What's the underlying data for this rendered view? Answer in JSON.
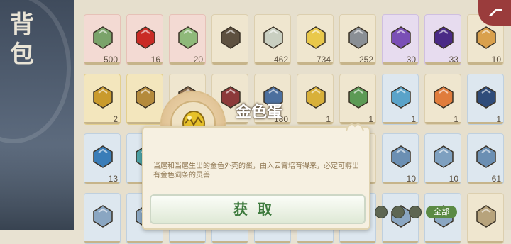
{
  "sidebar": {
    "title": "背包"
  },
  "inventory": {
    "rows": [
      [
        {
          "name": "shell-icon",
          "count": "500",
          "tint": "pink",
          "color": "#7aa36a"
        },
        {
          "name": "red-orb-icon",
          "count": "16",
          "tint": "pink",
          "color": "#c92b25"
        },
        {
          "name": "green-bun-icon",
          "count": "20",
          "tint": "pink",
          "color": "#8fb97a"
        },
        {
          "name": "dark-nut-icon",
          "count": "",
          "tint": "",
          "color": "#5e5140"
        },
        {
          "name": "bowl-icon",
          "count": "462",
          "tint": "",
          "color": "#c9cfc1"
        },
        {
          "name": "yellow-cake-icon",
          "count": "734",
          "tint": "",
          "color": "#e9c84a"
        },
        {
          "name": "grey-ore-icon",
          "count": "252",
          "tint": "",
          "color": "#8a8f95"
        },
        {
          "name": "purple-crystal-icon",
          "count": "30",
          "tint": "purple",
          "color": "#7a4fb6"
        },
        {
          "name": "purple-orb-icon",
          "count": "33",
          "tint": "purple",
          "color": "#4a2a86"
        },
        {
          "name": "food-icon",
          "count": "10",
          "tint": "",
          "color": "#d9a04c"
        }
      ],
      [
        {
          "name": "amber-crystal-icon",
          "count": "2",
          "tint": "gold",
          "color": "#c99a2c"
        },
        {
          "name": "scroll-icon",
          "count": "",
          "tint": "gold",
          "color": "#b48a3c"
        },
        {
          "name": "book-icon",
          "count": "",
          "tint": "",
          "color": "#8a6a4c"
        },
        {
          "name": "red-book-icon",
          "count": "",
          "tint": "",
          "color": "#8c3a3a"
        },
        {
          "name": "blue-card-icon",
          "count": "180",
          "tint": "",
          "color": "#4b6f9e"
        },
        {
          "name": "gold-ore-icon",
          "count": "1",
          "tint": "",
          "color": "#d8b03a"
        },
        {
          "name": "green-leaf-icon",
          "count": "1",
          "tint": "",
          "color": "#5c9a55"
        },
        {
          "name": "blue-gem-icon",
          "count": "1",
          "tint": "blue",
          "color": "#5aa3c9"
        },
        {
          "name": "orange-flower-icon",
          "count": "1",
          "tint": "",
          "color": "#e07c3c"
        },
        {
          "name": "dark-blue-gem-icon",
          "count": "1",
          "tint": "blue",
          "color": "#2f4c7a"
        }
      ],
      [
        {
          "name": "blue-orb-icon",
          "count": "13",
          "tint": "blue",
          "color": "#3a7db8"
        },
        {
          "name": "teal-feather-icon",
          "count": "",
          "tint": "blue",
          "color": "#4ba0a4"
        },
        {
          "name": "item-icon",
          "count": "",
          "tint": "",
          "color": "#b7a37c"
        },
        {
          "name": "item-icon",
          "count": "",
          "tint": "",
          "color": "#b7a37c"
        },
        {
          "name": "item-icon",
          "count": "",
          "tint": "",
          "color": "#b7a37c"
        },
        {
          "name": "item-icon",
          "count": "",
          "tint": "",
          "color": "#b7a37c"
        },
        {
          "name": "item-icon",
          "count": "",
          "tint": "",
          "color": "#b7a37c"
        },
        {
          "name": "puzzle-piece-icon",
          "count": "10",
          "tint": "blue",
          "color": "#6b8fb3"
        },
        {
          "name": "puzzle-piece-icon",
          "count": "10",
          "tint": "blue",
          "color": "#7ea0c0"
        },
        {
          "name": "puzzle-piece-icon",
          "count": "61",
          "tint": "blue",
          "color": "#6b8fb3"
        }
      ],
      [
        {
          "name": "puzzle-piece-icon",
          "count": "",
          "tint": "blue",
          "color": "#8aa6c2"
        },
        {
          "name": "puzzle-piece-icon",
          "count": "",
          "tint": "blue",
          "color": "#8aa6c2"
        },
        {
          "name": "puzzle-piece-icon",
          "count": "",
          "tint": "blue",
          "color": "#8aa6c2"
        },
        {
          "name": "puzzle-piece-icon",
          "count": "",
          "tint": "blue",
          "color": "#8aa6c2"
        },
        {
          "name": "puzzle-piece-icon",
          "count": "",
          "tint": "blue",
          "color": "#8aa6c2"
        },
        {
          "name": "puzzle-piece-icon",
          "count": "",
          "tint": "blue",
          "color": "#8aa6c2"
        },
        {
          "name": "puzzle-piece-icon",
          "count": "",
          "tint": "blue",
          "color": "#8aa6c2"
        },
        {
          "name": "puzzle-piece-icon",
          "count": "",
          "tint": "blue",
          "color": "#8aa6c2"
        },
        {
          "name": "puzzle-piece-icon",
          "count": "",
          "tint": "blue",
          "color": "#8aa6c2"
        },
        {
          "name": "item-icon",
          "count": "",
          "tint": "",
          "color": "#b7a37c"
        }
      ]
    ]
  },
  "popup": {
    "title": "金色蛋",
    "description": "当扈和当扈生出的金色外壳的蛋，由入云霄培育得来，必定可孵出有金色词条的灵兽",
    "acquire_label": "获取",
    "icon": "golden-egg-icon"
  },
  "filters": {
    "all_label": "全部"
  },
  "colors": {
    "accent": "#3d7a3d",
    "corner_tab": "#9a3c3c",
    "filter_active": "#5b8a44"
  }
}
